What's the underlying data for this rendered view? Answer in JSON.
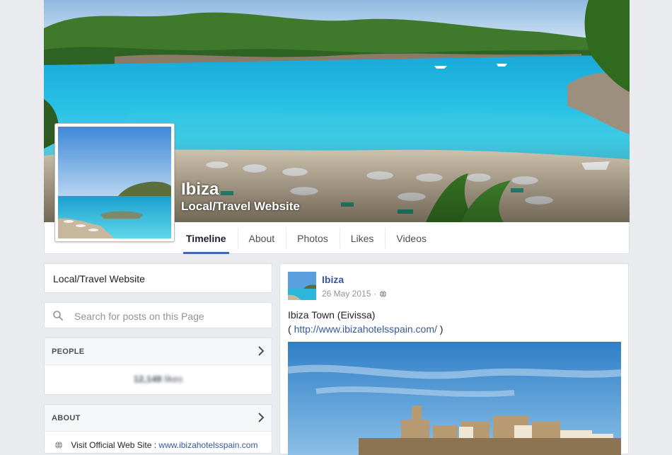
{
  "page": {
    "name": "Ibiza",
    "category": "Local/Travel Website"
  },
  "tabs": [
    {
      "label": "Timeline",
      "active": true
    },
    {
      "label": "About",
      "active": false
    },
    {
      "label": "Photos",
      "active": false
    },
    {
      "label": "Likes",
      "active": false
    },
    {
      "label": "Videos",
      "active": false
    }
  ],
  "sidebar": {
    "category_label": "Local/Travel Website",
    "search_placeholder": "Search for posts on this Page",
    "people": {
      "header": "PEOPLE",
      "likes_count": "12,148",
      "likes_label": "likes"
    },
    "about": {
      "header": "ABOUT",
      "line_prefix": "Visit Official Web Site :",
      "link_text": "www.ibizahotelsspain.com"
    }
  },
  "post": {
    "author": "Ibiza",
    "date": "26 May 2015",
    "separator": "·",
    "privacy_icon": "globe-icon",
    "text_line1": "Ibiza Town (Eivissa)",
    "text_open": "(",
    "link": "http://www.ibizahotelsspain.com/",
    "text_close": ")"
  },
  "colors": {
    "background": "#e9ebee",
    "link": "#365899",
    "tab_active_underline": "#4267b2",
    "sea": "#1fb6d8"
  }
}
